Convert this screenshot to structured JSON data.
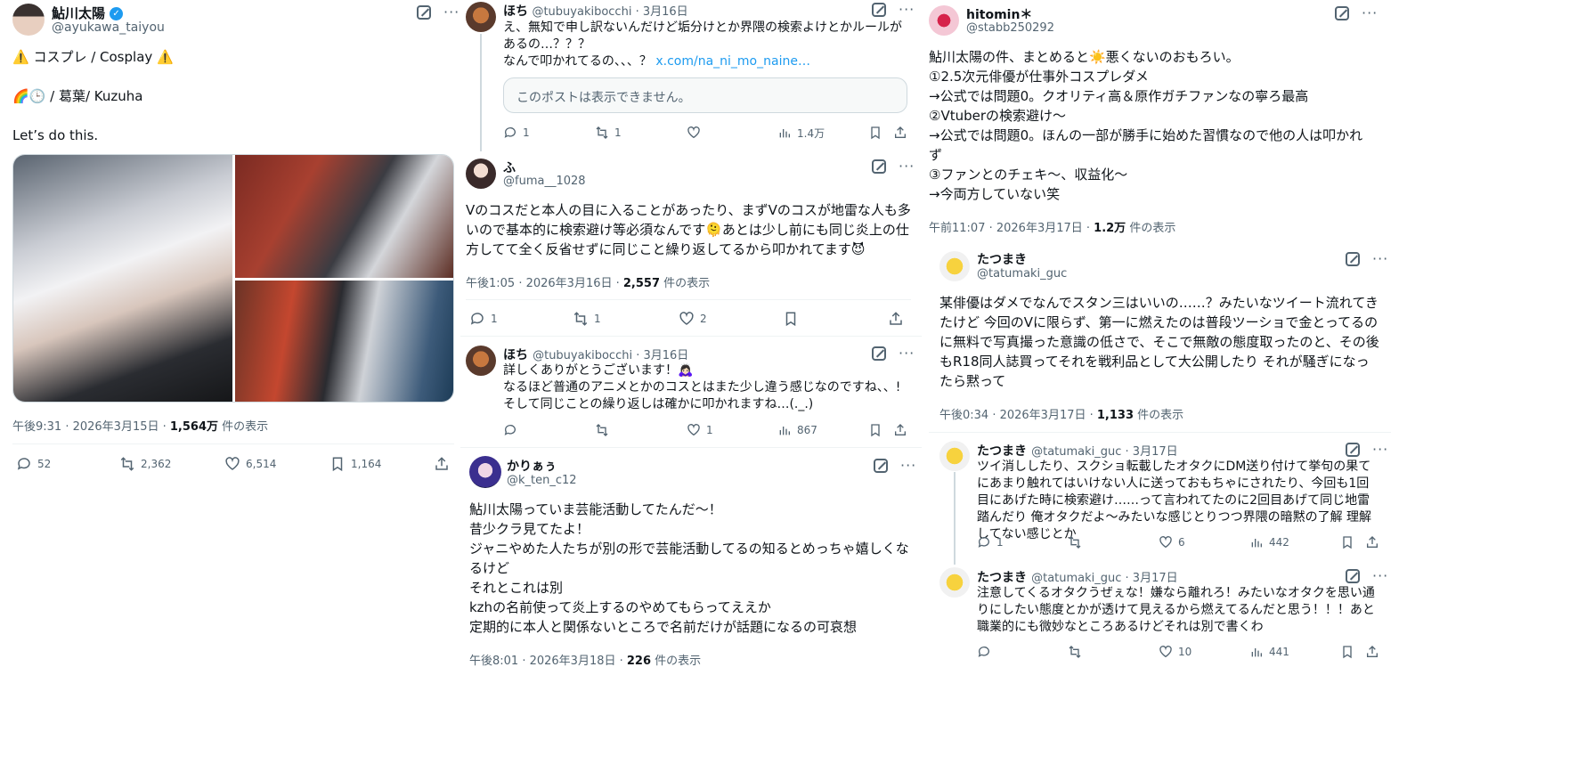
{
  "col1": {
    "author": {
      "name": "鮎川太陽",
      "handle": "@ayukawa_taiyou"
    },
    "lines": [
      "⚠️ コスプレ / Cosplay ⚠️",
      "🌈🕒 / 葛葉/ Kuzuha",
      "Let’s do this."
    ],
    "meta": {
      "time": "午後9:31 · 2026年3月15日 · ",
      "views": "1,564万",
      "views_suffix": " 件の表示"
    },
    "actions": {
      "replies": "52",
      "reposts": "2,362",
      "likes": "6,514",
      "bookmarks": "1,164"
    }
  },
  "col2": {
    "t1": {
      "name": "ほち",
      "handle": "@tubuyakibocchi · 3月16日",
      "text": "え、無知で申し訳ないんだけど垢分けとか界隈の検索よけとかルールがあるの…？？？\nなんで叩かれてるの、、、？ ",
      "link": "x.com/na_ni_mo_naine…",
      "quote": "このポストは表示できません。",
      "actions": {
        "replies": "1",
        "reposts": "1",
        "likes": "",
        "views": "1.4万"
      }
    },
    "t2": {
      "name": "ふ",
      "handle": "@fuma__1028",
      "text": "Vのコスだと本人の目に入ることがあったり、まずVのコスが地雷な人も多いので基本的に検索避け等必須なんです🫠あとは少し前にも同じ炎上の仕方してて全く反省せずに同じこと繰り返してるから叩かれてます😈",
      "meta": {
        "time": "午後1:05 · 2026年3月16日 · ",
        "views": "2,557",
        "views_suffix": " 件の表示"
      },
      "actions": {
        "replies": "1",
        "reposts": "1",
        "likes": "2"
      }
    },
    "t3": {
      "name": "ほち",
      "handle": "@tubuyakibocchi · 3月16日",
      "text": "詳しくありがとうございます！🙇🏻‍♀️\nなるほど普通のアニメとかのコスとはまた少し違う感じなのですね、、!\nそして同じことの繰り返しは確かに叩かれますね…(._.)",
      "actions": {
        "replies": "",
        "reposts": "",
        "likes": "1",
        "views": "867"
      }
    },
    "t4": {
      "name": "かりぁぅ",
      "handle": "@k_ten_c12",
      "text": "鮎川太陽っていま芸能活動してたんだ〜！\n昔少クラ見てたよ！\nジャニやめた人たちが別の形で芸能活動してるの知るとめっちゃ嬉しくなるけど\nそれとこれは別\nkzhの名前使って炎上するのやめてもらってええか\n定期的に本人と関係ないところで名前だけが話題になるの可哀想",
      "meta": {
        "time": "午後8:01 · 2026年3月18日 · ",
        "views": "226",
        "views_suffix": " 件の表示"
      }
    }
  },
  "col3": {
    "t1": {
      "name": "hitomin＊",
      "handle": "@stabb250292",
      "text": "鮎川太陽の件、まとめると☀️悪くないのおもろい。\n①2.5次元俳優が仕事外コスプレダメ\n→公式では問題0。クオリティ高＆原作ガチファンなの寧ろ最高\n②Vtuberの検索避け〜\n→公式では問題0。ほんの一部が勝手に始めた習慣なので他の人は叩かれず\n③ファンとのチェキ〜、収益化〜\n→今両方していない笑",
      "meta": {
        "time": "午前11:07 · 2026年3月17日 · ",
        "views": "1.2万",
        "views_suffix": " 件の表示"
      }
    },
    "t2": {
      "name": "たつまき",
      "handle": "@tatumaki_guc",
      "text": "某俳優はダメでなんでスタン三はいいの……？みたいなツイート流れてきたけど 今回のVに限らず、第一に燃えたのは普段ツーショで金とってるのに無料で写真撮った意識の低さで、そこで無敵の態度取ったのと、その後もR18同人誌買ってそれを戦利品として大公開したり それが騒ぎになったら黙って",
      "meta": {
        "time": "午後0:34 · 2026年3月17日 · ",
        "views": "1,133",
        "views_suffix": " 件の表示"
      }
    },
    "t3": {
      "name": "たつまき",
      "handle": "@tatumaki_guc · 3月17日",
      "text": "ツイ消ししたり、スクショ転載したオタクにDM送り付けて挙句の果てにあまり触れてはいけない人に送っておもちゃにされたり、今回も1回目にあげた時に検索避け……って言われてたのに2回目あげて同じ地雷踏んだり 俺オタクだよ〜みたいな感じとりつつ界隈の暗黙の了解 理解してない感じとか",
      "actions": {
        "replies": "1",
        "reposts": "",
        "likes": "6",
        "views": "442"
      }
    },
    "t4": {
      "name": "たつまき",
      "handle": "@tatumaki_guc · 3月17日",
      "text": "注意してくるオタクうぜぇな！嫌なら離れろ！みたいなオタクを思い通りにしたい態度とかが透けて見えるから燃えてるんだと思う！！！あと職業的にも微妙なところあるけどそれは別で書くわ",
      "actions": {
        "replies": "",
        "reposts": "",
        "likes": "10",
        "views": "441"
      }
    }
  }
}
